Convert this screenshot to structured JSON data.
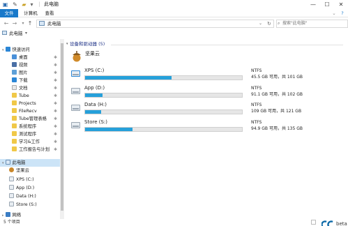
{
  "window": {
    "title": "此电脑",
    "controls": {
      "minimize": "—",
      "maximize": "☐",
      "close": "✕"
    }
  },
  "ribbon": {
    "tabs": [
      {
        "label": "文件",
        "active": true
      },
      {
        "label": "计算机"
      },
      {
        "label": "查看"
      }
    ],
    "help_icon": "?"
  },
  "address": {
    "path": "此电脑",
    "search_placeholder": "搜索\"此电脑\""
  },
  "toolbar2": {
    "label": "此电脑"
  },
  "sidebar": {
    "items": [
      {
        "label": "快速访问",
        "icon": "star-icon"
      },
      {
        "label": "桌面",
        "icon": "folder-icon",
        "pinned": true
      },
      {
        "label": "视频",
        "icon": "folder-icon",
        "pinned": true
      },
      {
        "label": "图片",
        "icon": "folder-icon",
        "pinned": true
      },
      {
        "label": "下载",
        "icon": "download-icon",
        "pinned": true
      },
      {
        "label": "文档",
        "icon": "folder-icon",
        "pinned": true
      },
      {
        "label": "Tube",
        "icon": "folder-icon",
        "pinned": true
      },
      {
        "label": "Projects",
        "icon": "folder-icon",
        "pinned": true
      },
      {
        "label": "FileRecv",
        "icon": "folder-icon",
        "pinned": true
      },
      {
        "label": "Tube管理表格",
        "icon": "folder-icon",
        "pinned": true
      },
      {
        "label": "系统程序",
        "icon": "folder-icon",
        "pinned": true
      },
      {
        "label": "测试程序",
        "icon": "folder-icon",
        "pinned": true
      },
      {
        "label": "学习&工作",
        "icon": "folder-icon",
        "pinned": true
      },
      {
        "label": "工作报告与计划",
        "icon": "folder-icon",
        "pinned": true
      },
      {
        "label": "此电脑",
        "icon": "pc-icon",
        "selected": true
      },
      {
        "label": "坚果云",
        "icon": "nut-icon"
      },
      {
        "label": "XPS (C:)",
        "icon": "drive-icon"
      },
      {
        "label": "App (D:)",
        "icon": "drive-icon"
      },
      {
        "label": "Data (H:)",
        "icon": "drive-icon"
      },
      {
        "label": "Store (S:)",
        "icon": "drive-icon"
      },
      {
        "label": "网络",
        "icon": "network-icon"
      }
    ],
    "pin_glyph": "✱"
  },
  "main": {
    "group_header": "设备和驱动器 (5)",
    "cloud_item": "坚果云",
    "drives": [
      {
        "name": "XPS (C:)",
        "fs": "NTFS",
        "free_text": "45.5 GB 可用，共 101 GB",
        "used_fraction": 0.55
      },
      {
        "name": "App (D:)",
        "fs": "NTFS",
        "free_text": "91.1 GB 可用，共 102 GB",
        "used_fraction": 0.11
      },
      {
        "name": "Data (H:)",
        "fs": "NTFS",
        "free_text": "109 GB 可用，共 121 GB",
        "used_fraction": 0.1
      },
      {
        "name": "Store (S:)",
        "fs": "NTFS",
        "free_text": "94.9 GB 可用，共 135 GB",
        "used_fraction": 0.3
      }
    ]
  },
  "status": {
    "text": "5 个项目",
    "brand": "beta"
  },
  "colors": {
    "accent": "#1979ca",
    "bar_fill": "#26a0da",
    "selection": "#cce4f7"
  }
}
